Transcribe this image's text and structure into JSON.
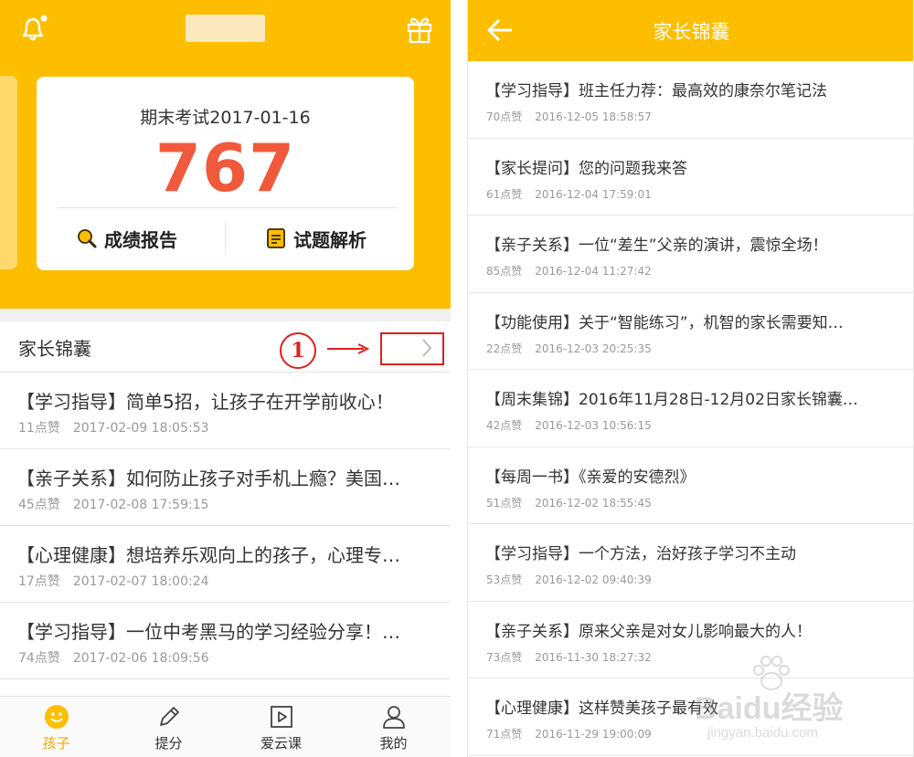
{
  "left": {
    "exam_title": "期末考试2017-01-16",
    "score": "767",
    "btn_report": "成绩报告",
    "btn_analysis": "试题解析",
    "section_title": "家长锦囊",
    "annotation_number": "1",
    "items": [
      {
        "title": "【学习指导】简单5招，让孩子在开学前收心！",
        "likes": "11点赞",
        "time": "2017-02-09 18:05:53"
      },
      {
        "title": "【亲子关系】如何防止孩子对手机上瘾？美国…",
        "likes": "45点赞",
        "time": "2017-02-08 17:59:15"
      },
      {
        "title": "【心理健康】想培养乐观向上的孩子，心理专…",
        "likes": "17点赞",
        "time": "2017-02-07 18:00:24"
      },
      {
        "title": "【学习指导】一位中考黑马的学习经验分享！…",
        "likes": "74点赞",
        "time": "2017-02-06 18:09:56"
      }
    ],
    "tabs": [
      {
        "label": "孩子",
        "icon": "smiley-icon",
        "active": true
      },
      {
        "label": "提分",
        "icon": "pencil-icon",
        "active": false
      },
      {
        "label": "爱云课",
        "icon": "play-icon",
        "active": false
      },
      {
        "label": "我的",
        "icon": "person-icon",
        "active": false
      }
    ]
  },
  "right": {
    "title": "家长锦囊",
    "items": [
      {
        "title": "【学习指导】班主任力荐：最高效的康奈尔笔记法",
        "likes": "70点赞",
        "time": "2016-12-05 18:58:57"
      },
      {
        "title": "【家长提问】您的问题我来答",
        "likes": "61点赞",
        "time": "2016-12-04 17:59:01"
      },
      {
        "title": "【亲子关系】一位“差生”父亲的演讲，震惊全场！",
        "likes": "85点赞",
        "time": "2016-12-04 11:27:42"
      },
      {
        "title": "【功能使用】关于“智能练习”，机智的家长需要知…",
        "likes": "22点赞",
        "time": "2016-12-03 20:25:35"
      },
      {
        "title": "【周末集锦】2016年11月28日-12月02日家长锦囊…",
        "likes": "42点赞",
        "time": "2016-12-03 10:56:15"
      },
      {
        "title": "【每周一书】《亲爱的安德烈》",
        "likes": "51点赞",
        "time": "2016-12-02 18:55:45"
      },
      {
        "title": "【学习指导】一个方法，治好孩子学习不主动",
        "likes": "53点赞",
        "time": "2016-12-02 09:40:39"
      },
      {
        "title": "【亲子关系】原来父亲是对女儿影响最大的人！",
        "likes": "73点赞",
        "time": "2016-11-30 18:27:32"
      },
      {
        "title": "【心理健康】这样赞美孩子最有效",
        "likes": "71点赞",
        "time": "2016-11-29 19:00:09"
      }
    ]
  },
  "watermark": {
    "text": "Baidu经验",
    "sub": "jingyan.baidu.com"
  },
  "colors": {
    "brand": "#FDBE00",
    "score": "#F0593B",
    "annotation": "#E02020",
    "tab_active": "#F0A800"
  }
}
